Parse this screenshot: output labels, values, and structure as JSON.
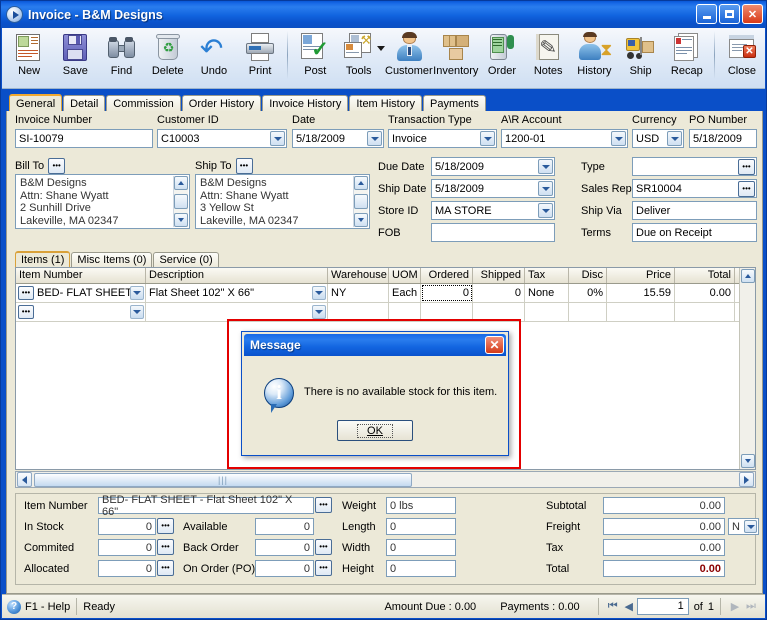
{
  "window": {
    "title": "Invoice - B&M Designs",
    "icon": "play-circle-icon",
    "buttons": {
      "minimize": "minimize-button",
      "maximize": "maximize-button",
      "close": "close-button"
    }
  },
  "toolbar": {
    "items": [
      {
        "label": "New",
        "icon": "new-document-icon"
      },
      {
        "label": "Save",
        "icon": "floppy-disk-icon"
      },
      {
        "label": "Find",
        "icon": "binoculars-icon"
      },
      {
        "label": "Delete",
        "icon": "recycle-bin-icon"
      },
      {
        "label": "Undo",
        "icon": "undo-arrow-icon"
      },
      {
        "label": "Print",
        "icon": "printer-icon"
      },
      {
        "label": "Post",
        "icon": "post-checkmark-icon"
      },
      {
        "label": "Tools",
        "icon": "tools-wrench-icon"
      },
      {
        "label": "Customer",
        "icon": "customer-person-icon"
      },
      {
        "label": "Inventory",
        "icon": "inventory-boxes-icon"
      },
      {
        "label": "Order",
        "icon": "order-device-icon"
      },
      {
        "label": "Notes",
        "icon": "notepad-pencil-icon"
      },
      {
        "label": "History",
        "icon": "history-hourglass-icon"
      },
      {
        "label": "Ship",
        "icon": "forklift-ship-icon"
      },
      {
        "label": "Recap",
        "icon": "recap-pages-icon"
      },
      {
        "label": "Close",
        "icon": "close-window-icon"
      }
    ]
  },
  "tabs": {
    "items": [
      "General",
      "Detail",
      "Commission",
      "Order History",
      "Invoice History",
      "Item History",
      "Payments"
    ],
    "active": "General"
  },
  "header_form": {
    "invoice_number": {
      "label": "Invoice Number",
      "value": "SI-10079"
    },
    "customer_id": {
      "label": "Customer ID",
      "value": "C10003"
    },
    "date": {
      "label": "Date",
      "value": "5/18/2009"
    },
    "transaction_type": {
      "label": "Transaction Type",
      "value": "Invoice"
    },
    "ar_account": {
      "label": "A\\R Account",
      "value": "1200-01"
    },
    "currency": {
      "label": "Currency",
      "value": "USD"
    },
    "po_number": {
      "label": "PO Number",
      "value": "5/18/2009"
    },
    "bill_to": {
      "label": "Bill To",
      "lines": [
        "B&M Designs",
        "Attn: Shane Wyatt",
        "2 Sunhill Drive",
        "Lakeville, MA 02347"
      ]
    },
    "ship_to": {
      "label": "Ship To",
      "lines": [
        "B&M Designs",
        "Attn: Shane Wyatt",
        "3 Yellow St",
        "Lakeville, MA 02347"
      ]
    },
    "due_date": {
      "label": "Due Date",
      "value": "5/18/2009"
    },
    "ship_date": {
      "label": "Ship Date",
      "value": "5/18/2009"
    },
    "store_id": {
      "label": "Store ID",
      "value": "MA STORE"
    },
    "fob": {
      "label": "FOB",
      "value": ""
    },
    "type": {
      "label": "Type",
      "value": ""
    },
    "sales_rep": {
      "label": "Sales Rep",
      "value": "SR10004"
    },
    "ship_via": {
      "label": "Ship Via",
      "value": "Deliver"
    },
    "terms": {
      "label": "Terms",
      "value": "Due on Receipt"
    }
  },
  "item_tabs": {
    "items": [
      "Items (1)",
      "Misc Items (0)",
      "Service (0)"
    ],
    "active": "Items (1)"
  },
  "grid": {
    "columns": [
      "Item Number",
      "Description",
      "Warehouse",
      "UOM",
      "Ordered",
      "Shipped",
      "Tax",
      "Disc",
      "Price",
      "Total"
    ],
    "rows": [
      {
        "item_number": "BED- FLAT SHEET",
        "description": "Flat Sheet 102\" X 66\"",
        "warehouse": "NY",
        "uom": "Each",
        "ordered": "0",
        "shipped": "0",
        "tax": "None",
        "disc": "0%",
        "price": "15.59",
        "total": "0.00"
      },
      {
        "item_number": "",
        "description": "",
        "warehouse": "",
        "uom": "",
        "ordered": "",
        "shipped": "",
        "tax": "",
        "disc": "",
        "price": "",
        "total": ""
      }
    ]
  },
  "detail_panel": {
    "item_number": {
      "label": "Item Number",
      "value": "BED- FLAT SHEET - Flat Sheet 102\" X 66\""
    },
    "in_stock": {
      "label": "In Stock",
      "value": "0"
    },
    "committed": {
      "label": "Commited",
      "value": "0"
    },
    "allocated": {
      "label": "Allocated",
      "value": "0"
    },
    "available": {
      "label": "Available",
      "value": "0"
    },
    "back_order": {
      "label": "Back Order",
      "value": "0"
    },
    "on_order_po": {
      "label": "On Order (PO)",
      "value": "0"
    },
    "weight": {
      "label": "Weight",
      "value": "0 lbs"
    },
    "length": {
      "label": "Length",
      "value": "0"
    },
    "width": {
      "label": "Width",
      "value": "0"
    },
    "height": {
      "label": "Height",
      "value": "0"
    },
    "subtotal": {
      "label": "Subtotal",
      "value": "0.00"
    },
    "freight": {
      "label": "Freight",
      "value": "0.00",
      "taxable": "N"
    },
    "tax": {
      "label": "Tax",
      "value": "0.00"
    },
    "total": {
      "label": "Total",
      "value": "0.00"
    }
  },
  "dialog": {
    "title": "Message",
    "icon": "information-icon",
    "message": "There is no available stock for this item.",
    "ok_label": "OK",
    "close_label": "✕"
  },
  "statusbar": {
    "help": "F1 - Help",
    "state": "Ready",
    "amount_due": "Amount Due : 0.00",
    "payments": "Payments : 0.00",
    "page": "1",
    "of_label": "of",
    "page_count": "1"
  },
  "colors": {
    "title_blue": "#0a4fc8",
    "face": "#ece9d8",
    "highlight_red": "#e30000",
    "total_red": "#8b0000",
    "tab_accent": "#f0a830"
  }
}
